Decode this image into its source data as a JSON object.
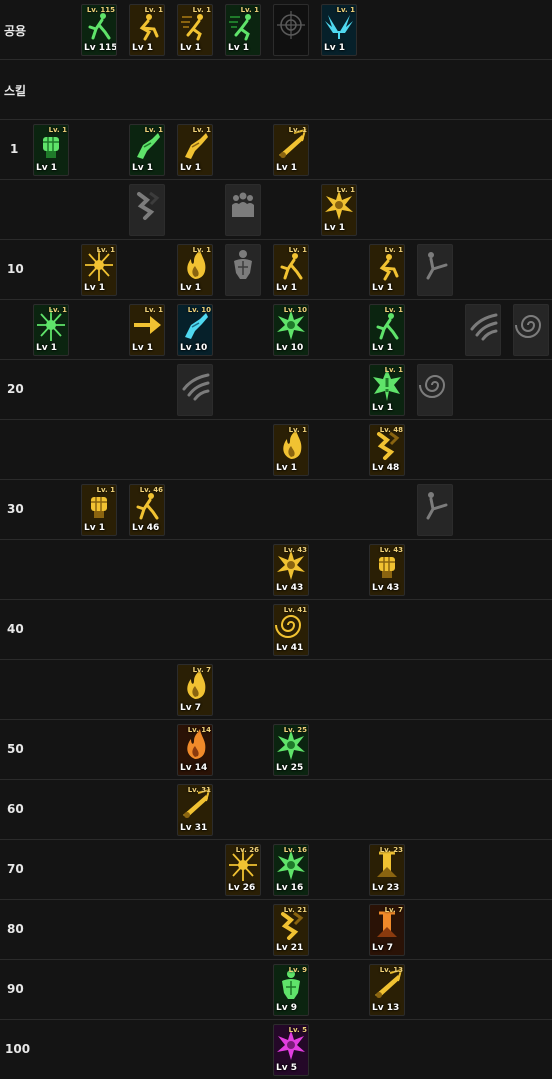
{
  "rows": [
    {
      "label": "공용",
      "skills": [
        {
          "slot": 1,
          "level": "Lv 115",
          "top": "Lv. 115",
          "theme": "green",
          "icon": "running-figure-icon"
        },
        {
          "slot": 2,
          "level": "Lv 1",
          "top": "Lv. 1",
          "theme": "gold",
          "icon": "crouching-figure-icon"
        },
        {
          "slot": 3,
          "level": "Lv 1",
          "top": "Lv. 1",
          "theme": "gold",
          "icon": "dash-figure-icon"
        },
        {
          "slot": 4,
          "level": "Lv 1",
          "top": "Lv. 1",
          "theme": "green",
          "icon": "dash-figure-icon"
        },
        {
          "slot": 5,
          "level": "",
          "top": "",
          "theme": "dark",
          "icon": "crosshair-icon"
        },
        {
          "slot": 6,
          "level": "Lv 1",
          "top": "Lv. 1",
          "theme": "cyan",
          "icon": "wings-icon"
        }
      ]
    },
    {
      "label": "스킬",
      "skills": []
    },
    {
      "label": "1",
      "skills": [
        {
          "slot": 0,
          "level": "Lv 1",
          "top": "Lv. 1",
          "theme": "green",
          "icon": "fist-icon"
        },
        {
          "slot": 2,
          "level": "Lv 1",
          "top": "Lv. 1",
          "theme": "green",
          "icon": "arm-icon"
        },
        {
          "slot": 3,
          "level": "Lv 1",
          "top": "Lv. 1",
          "theme": "gold",
          "icon": "arm-icon"
        },
        {
          "slot": 5,
          "level": "Lv 1",
          "top": "Lv. 1",
          "theme": "gold",
          "icon": "strike-icon"
        }
      ]
    },
    {
      "label": "",
      "skills": [
        {
          "slot": 2,
          "level": "",
          "top": "",
          "theme": "locked",
          "icon": "chain-icon"
        },
        {
          "slot": 4,
          "level": "",
          "top": "",
          "theme": "locked",
          "icon": "group-icon"
        },
        {
          "slot": 6,
          "level": "Lv 1",
          "top": "Lv. 1",
          "theme": "gold",
          "icon": "burst-icon"
        }
      ]
    },
    {
      "label": "10",
      "skills": [
        {
          "slot": 1,
          "level": "Lv 1",
          "top": "Lv. 1",
          "theme": "gold",
          "icon": "spark-icon"
        },
        {
          "slot": 3,
          "level": "Lv 1",
          "top": "Lv. 1",
          "theme": "gold",
          "icon": "flame-icon"
        },
        {
          "slot": 4,
          "level": "",
          "top": "",
          "theme": "locked",
          "icon": "torso-icon"
        },
        {
          "slot": 5,
          "level": "Lv 1",
          "top": "Lv. 1",
          "theme": "gold",
          "icon": "running-figure-icon"
        },
        {
          "slot": 7,
          "level": "Lv 1",
          "top": "Lv. 1",
          "theme": "gold",
          "icon": "crouching-figure-icon"
        },
        {
          "slot": 8,
          "level": "",
          "top": "",
          "theme": "locked",
          "icon": "kick-icon"
        }
      ]
    },
    {
      "label": "",
      "skills": [
        {
          "slot": 0,
          "level": "Lv 1",
          "top": "Lv. 1",
          "theme": "green",
          "icon": "spark-icon"
        },
        {
          "slot": 2,
          "level": "Lv 1",
          "top": "Lv. 1",
          "theme": "gold",
          "icon": "arrow-icon"
        },
        {
          "slot": 3,
          "level": "Lv 10",
          "top": "Lv. 10",
          "theme": "cyan",
          "icon": "arm-icon"
        },
        {
          "slot": 5,
          "level": "Lv 10",
          "top": "Lv. 10",
          "theme": "green",
          "icon": "burst-icon"
        },
        {
          "slot": 7,
          "level": "Lv 1",
          "top": "Lv. 1",
          "theme": "green",
          "icon": "running-figure-icon"
        },
        {
          "slot": 9,
          "level": "",
          "top": "",
          "theme": "locked",
          "icon": "wind-icon"
        },
        {
          "slot": 10,
          "level": "",
          "top": "",
          "theme": "locked",
          "icon": "swirl-icon"
        }
      ]
    },
    {
      "label": "20",
      "skills": [
        {
          "slot": 3,
          "level": "",
          "top": "",
          "theme": "locked",
          "icon": "wind-icon"
        },
        {
          "slot": 7,
          "level": "Lv 1",
          "top": "Lv. 1",
          "theme": "green",
          "icon": "alert-icon"
        },
        {
          "slot": 8,
          "level": "",
          "top": "",
          "theme": "locked",
          "icon": "swirl-icon"
        }
      ]
    },
    {
      "label": "",
      "skills": [
        {
          "slot": 5,
          "level": "Lv 1",
          "top": "Lv. 1",
          "theme": "gold",
          "icon": "flame-icon"
        },
        {
          "slot": 7,
          "level": "Lv 48",
          "top": "Lv. 48",
          "theme": "gold",
          "icon": "chain-icon"
        }
      ]
    },
    {
      "label": "30",
      "skills": [
        {
          "slot": 1,
          "level": "Lv 1",
          "top": "Lv. 1",
          "theme": "gold",
          "icon": "fist-icon"
        },
        {
          "slot": 2,
          "level": "Lv 46",
          "top": "Lv. 46",
          "theme": "gold",
          "icon": "running-figure-icon"
        },
        {
          "slot": 8,
          "level": "",
          "top": "",
          "theme": "locked",
          "icon": "kick-icon"
        }
      ]
    },
    {
      "label": "",
      "skills": [
        {
          "slot": 5,
          "level": "Lv 43",
          "top": "Lv. 43",
          "theme": "gold",
          "icon": "burst-icon"
        },
        {
          "slot": 7,
          "level": "Lv 43",
          "top": "Lv. 43",
          "theme": "gold",
          "icon": "fist-icon"
        }
      ]
    },
    {
      "label": "40",
      "skills": [
        {
          "slot": 5,
          "level": "Lv 41",
          "top": "Lv. 41",
          "theme": "gold",
          "icon": "swirl-icon"
        }
      ]
    },
    {
      "label": "",
      "skills": [
        {
          "slot": 3,
          "level": "Lv 7",
          "top": "Lv. 7",
          "theme": "gold",
          "icon": "flame-icon"
        }
      ]
    },
    {
      "label": "50",
      "skills": [
        {
          "slot": 3,
          "level": "Lv 14",
          "top": "Lv. 14",
          "theme": "orange",
          "icon": "flame-icon"
        },
        {
          "slot": 5,
          "level": "Lv 25",
          "top": "Lv. 25",
          "theme": "green",
          "icon": "burst-icon"
        }
      ]
    },
    {
      "label": "60",
      "skills": [
        {
          "slot": 3,
          "level": "Lv 31",
          "top": "Lv. 31",
          "theme": "gold",
          "icon": "strike-icon"
        }
      ]
    },
    {
      "label": "70",
      "skills": [
        {
          "slot": 4,
          "level": "Lv 26",
          "top": "Lv. 26",
          "theme": "gold",
          "icon": "spark-icon"
        },
        {
          "slot": 5,
          "level": "Lv 16",
          "top": "Lv. 16",
          "theme": "green",
          "icon": "burst-icon"
        },
        {
          "slot": 7,
          "level": "Lv 23",
          "top": "Lv. 23",
          "theme": "gold",
          "icon": "pillar-icon"
        }
      ]
    },
    {
      "label": "80",
      "skills": [
        {
          "slot": 5,
          "level": "Lv 21",
          "top": "Lv. 21",
          "theme": "gold",
          "icon": "chain-icon"
        },
        {
          "slot": 7,
          "level": "Lv 7",
          "top": "Lv. 7",
          "theme": "orange",
          "icon": "pillar-icon"
        }
      ]
    },
    {
      "label": "90",
      "skills": [
        {
          "slot": 5,
          "level": "Lv 9",
          "top": "Lv. 9",
          "theme": "green",
          "icon": "torso-icon"
        },
        {
          "slot": 7,
          "level": "Lv 13",
          "top": "Lv. 13",
          "theme": "gold",
          "icon": "strike-icon"
        }
      ]
    },
    {
      "label": "100",
      "skills": [
        {
          "slot": 5,
          "level": "Lv 5",
          "top": "Lv. 5",
          "theme": "magenta",
          "icon": "burst-icon"
        }
      ]
    }
  ],
  "themes": {
    "gold": {
      "bg": "#2a1f05",
      "fg": "#f1c232",
      "fg2": "#8a6410"
    },
    "green": {
      "bg": "#0b2410",
      "fg": "#5fe36a",
      "fg2": "#1f7a2a"
    },
    "cyan": {
      "bg": "#06202a",
      "fg": "#4fd8f0",
      "fg2": "#1a6c86"
    },
    "orange": {
      "bg": "#2a1206",
      "fg": "#f08a2a",
      "fg2": "#8a3a0e"
    },
    "magenta": {
      "bg": "#240828",
      "fg": "#e23ee0",
      "fg2": "#7a1c7a"
    },
    "locked": {
      "bg": "#262626",
      "fg": "#7c7c7c",
      "fg2": "#3c3c3c"
    },
    "dark": {
      "bg": "#101010",
      "fg": "#5a5a5a",
      "fg2": "#2a2a2a"
    }
  }
}
